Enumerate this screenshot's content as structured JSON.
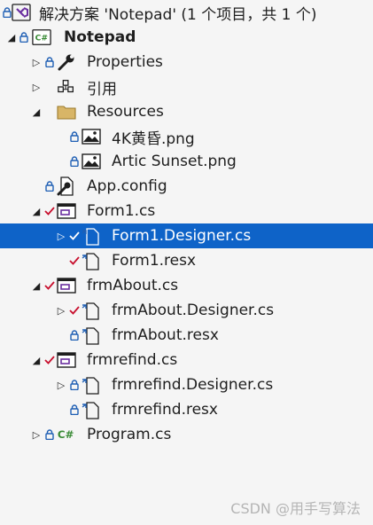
{
  "watermark": "CSDN @用手写算法",
  "items": [
    {
      "label": "解决方案 'Notepad' (1 个项目，共 1 个)",
      "icon": "solution-icon",
      "overlay": "lock",
      "expander": "none"
    },
    {
      "label": "Notepad",
      "icon": "csharp-project-icon",
      "overlay": "lock",
      "expander": "expanded",
      "bold": true
    },
    {
      "label": "Properties",
      "icon": "wrench-icon",
      "overlay": "lock",
      "expander": "collapsed"
    },
    {
      "label": "引用",
      "icon": "references-icon",
      "overlay": "none",
      "expander": "collapsed"
    },
    {
      "label": "Resources",
      "icon": "folder-icon",
      "overlay": "none",
      "expander": "expanded"
    },
    {
      "label": "4K黄昏.png",
      "icon": "image-file-icon",
      "overlay": "lock",
      "expander": "none"
    },
    {
      "label": "Artic Sunset.png",
      "icon": "image-file-icon",
      "overlay": "lock",
      "expander": "none"
    },
    {
      "label": "App.config",
      "icon": "config-file-icon",
      "overlay": "lock",
      "expander": "none"
    },
    {
      "label": "Form1.cs",
      "icon": "form-icon",
      "overlay": "check",
      "expander": "expanded"
    },
    {
      "label": "Form1.Designer.cs",
      "icon": "code-file-icon",
      "overlay": "check",
      "expander": "collapsed",
      "selected": true
    },
    {
      "label": "Form1.resx",
      "icon": "code-file-icon",
      "overlay": "check",
      "expander": "none"
    },
    {
      "label": "frmAbout.cs",
      "icon": "form-icon",
      "overlay": "check",
      "expander": "expanded"
    },
    {
      "label": "frmAbout.Designer.cs",
      "icon": "code-file-icon",
      "overlay": "check",
      "expander": "collapsed"
    },
    {
      "label": "frmAbout.resx",
      "icon": "code-file-icon",
      "overlay": "lock",
      "expander": "none"
    },
    {
      "label": "frmrefind.cs",
      "icon": "form-icon",
      "overlay": "check",
      "expander": "expanded"
    },
    {
      "label": "frmrefind.Designer.cs",
      "icon": "code-file-icon",
      "overlay": "lock",
      "expander": "collapsed"
    },
    {
      "label": "frmrefind.resx",
      "icon": "code-file-icon",
      "overlay": "lock",
      "expander": "none"
    },
    {
      "label": "Program.cs",
      "icon": "csharp-file-icon",
      "overlay": "lock",
      "expander": "collapsed"
    }
  ],
  "colors": {
    "selection": "#0e63c8",
    "lock": "#1f5fb4",
    "check": "#c8102e",
    "csharp": "#388a34"
  }
}
